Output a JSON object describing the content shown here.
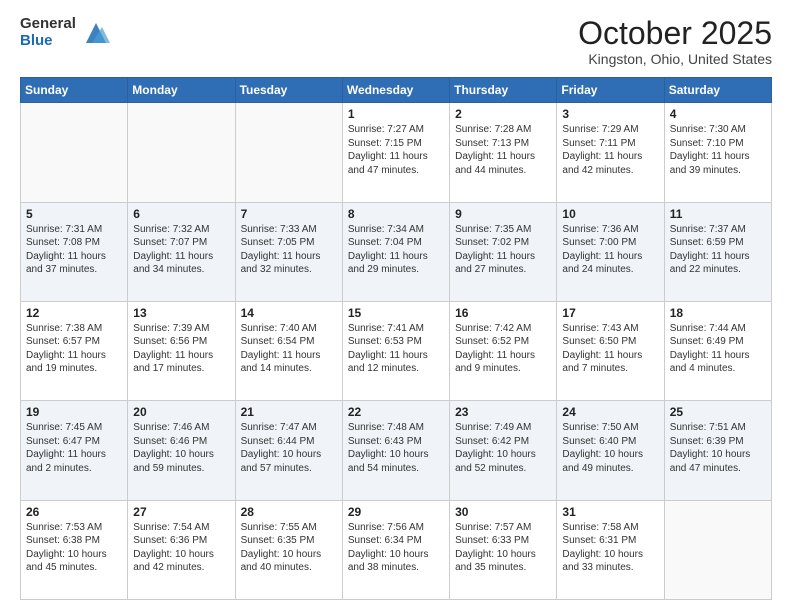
{
  "header": {
    "logo_general": "General",
    "logo_blue": "Blue",
    "month_title": "October 2025",
    "location": "Kingston, Ohio, United States"
  },
  "days_of_week": [
    "Sunday",
    "Monday",
    "Tuesday",
    "Wednesday",
    "Thursday",
    "Friday",
    "Saturday"
  ],
  "weeks": [
    [
      {
        "day": "",
        "info": ""
      },
      {
        "day": "",
        "info": ""
      },
      {
        "day": "",
        "info": ""
      },
      {
        "day": "1",
        "info": "Sunrise: 7:27 AM\nSunset: 7:15 PM\nDaylight: 11 hours and 47 minutes."
      },
      {
        "day": "2",
        "info": "Sunrise: 7:28 AM\nSunset: 7:13 PM\nDaylight: 11 hours and 44 minutes."
      },
      {
        "day": "3",
        "info": "Sunrise: 7:29 AM\nSunset: 7:11 PM\nDaylight: 11 hours and 42 minutes."
      },
      {
        "day": "4",
        "info": "Sunrise: 7:30 AM\nSunset: 7:10 PM\nDaylight: 11 hours and 39 minutes."
      }
    ],
    [
      {
        "day": "5",
        "info": "Sunrise: 7:31 AM\nSunset: 7:08 PM\nDaylight: 11 hours and 37 minutes."
      },
      {
        "day": "6",
        "info": "Sunrise: 7:32 AM\nSunset: 7:07 PM\nDaylight: 11 hours and 34 minutes."
      },
      {
        "day": "7",
        "info": "Sunrise: 7:33 AM\nSunset: 7:05 PM\nDaylight: 11 hours and 32 minutes."
      },
      {
        "day": "8",
        "info": "Sunrise: 7:34 AM\nSunset: 7:04 PM\nDaylight: 11 hours and 29 minutes."
      },
      {
        "day": "9",
        "info": "Sunrise: 7:35 AM\nSunset: 7:02 PM\nDaylight: 11 hours and 27 minutes."
      },
      {
        "day": "10",
        "info": "Sunrise: 7:36 AM\nSunset: 7:00 PM\nDaylight: 11 hours and 24 minutes."
      },
      {
        "day": "11",
        "info": "Sunrise: 7:37 AM\nSunset: 6:59 PM\nDaylight: 11 hours and 22 minutes."
      }
    ],
    [
      {
        "day": "12",
        "info": "Sunrise: 7:38 AM\nSunset: 6:57 PM\nDaylight: 11 hours and 19 minutes."
      },
      {
        "day": "13",
        "info": "Sunrise: 7:39 AM\nSunset: 6:56 PM\nDaylight: 11 hours and 17 minutes."
      },
      {
        "day": "14",
        "info": "Sunrise: 7:40 AM\nSunset: 6:54 PM\nDaylight: 11 hours and 14 minutes."
      },
      {
        "day": "15",
        "info": "Sunrise: 7:41 AM\nSunset: 6:53 PM\nDaylight: 11 hours and 12 minutes."
      },
      {
        "day": "16",
        "info": "Sunrise: 7:42 AM\nSunset: 6:52 PM\nDaylight: 11 hours and 9 minutes."
      },
      {
        "day": "17",
        "info": "Sunrise: 7:43 AM\nSunset: 6:50 PM\nDaylight: 11 hours and 7 minutes."
      },
      {
        "day": "18",
        "info": "Sunrise: 7:44 AM\nSunset: 6:49 PM\nDaylight: 11 hours and 4 minutes."
      }
    ],
    [
      {
        "day": "19",
        "info": "Sunrise: 7:45 AM\nSunset: 6:47 PM\nDaylight: 11 hours and 2 minutes."
      },
      {
        "day": "20",
        "info": "Sunrise: 7:46 AM\nSunset: 6:46 PM\nDaylight: 10 hours and 59 minutes."
      },
      {
        "day": "21",
        "info": "Sunrise: 7:47 AM\nSunset: 6:44 PM\nDaylight: 10 hours and 57 minutes."
      },
      {
        "day": "22",
        "info": "Sunrise: 7:48 AM\nSunset: 6:43 PM\nDaylight: 10 hours and 54 minutes."
      },
      {
        "day": "23",
        "info": "Sunrise: 7:49 AM\nSunset: 6:42 PM\nDaylight: 10 hours and 52 minutes."
      },
      {
        "day": "24",
        "info": "Sunrise: 7:50 AM\nSunset: 6:40 PM\nDaylight: 10 hours and 49 minutes."
      },
      {
        "day": "25",
        "info": "Sunrise: 7:51 AM\nSunset: 6:39 PM\nDaylight: 10 hours and 47 minutes."
      }
    ],
    [
      {
        "day": "26",
        "info": "Sunrise: 7:53 AM\nSunset: 6:38 PM\nDaylight: 10 hours and 45 minutes."
      },
      {
        "day": "27",
        "info": "Sunrise: 7:54 AM\nSunset: 6:36 PM\nDaylight: 10 hours and 42 minutes."
      },
      {
        "day": "28",
        "info": "Sunrise: 7:55 AM\nSunset: 6:35 PM\nDaylight: 10 hours and 40 minutes."
      },
      {
        "day": "29",
        "info": "Sunrise: 7:56 AM\nSunset: 6:34 PM\nDaylight: 10 hours and 38 minutes."
      },
      {
        "day": "30",
        "info": "Sunrise: 7:57 AM\nSunset: 6:33 PM\nDaylight: 10 hours and 35 minutes."
      },
      {
        "day": "31",
        "info": "Sunrise: 7:58 AM\nSunset: 6:31 PM\nDaylight: 10 hours and 33 minutes."
      },
      {
        "day": "",
        "info": ""
      }
    ]
  ]
}
